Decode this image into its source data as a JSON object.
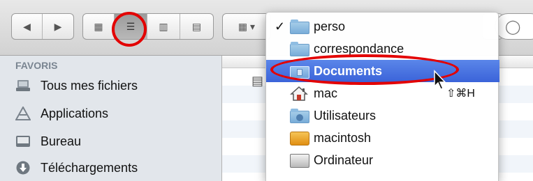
{
  "toolbar": {
    "back_glyph": "◀",
    "forward_glyph": "▶",
    "view_icons_glyph": "▦",
    "view_list_glyph": "☰",
    "view_columns_glyph": "▥",
    "view_coverflow_glyph": "▤",
    "arrange_glyph": "▦ ▾"
  },
  "sidebar": {
    "header": "FAVORIS",
    "items": [
      {
        "label": "Tous mes fichiers",
        "icon": "all-files-icon"
      },
      {
        "label": "Applications",
        "icon": "applications-icon"
      },
      {
        "label": "Bureau",
        "icon": "desktop-icon"
      },
      {
        "label": "Téléchargements",
        "icon": "downloads-icon"
      }
    ]
  },
  "menu": {
    "checkmark": "✓",
    "items": [
      {
        "label": "perso",
        "icon": "folder-icon",
        "checked": true
      },
      {
        "label": "correspondance",
        "icon": "folder-icon"
      },
      {
        "label": "Documents",
        "icon": "documents-folder-icon",
        "highlighted": true
      },
      {
        "label": "mac",
        "icon": "home-icon",
        "shortcut": "⇧⌘H"
      },
      {
        "label": "Utilisateurs",
        "icon": "users-folder-icon"
      },
      {
        "label": "macintosh",
        "icon": "hard-drive-icon"
      },
      {
        "label": "Ordinateur",
        "icon": "computer-icon"
      }
    ]
  },
  "colors": {
    "highlight": "#3b63d9",
    "annotation": "#e30000",
    "sidebar_bg": "#e2e6eb"
  }
}
